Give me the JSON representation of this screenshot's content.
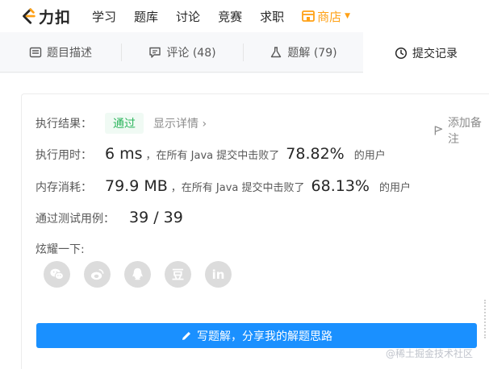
{
  "nav": {
    "logo_text": "力扣",
    "items": [
      "学习",
      "题库",
      "讨论",
      "竞赛",
      "求职"
    ],
    "shop_label": "商店",
    "accent_color": "#ffa116"
  },
  "tabs": [
    {
      "label": "题目描述",
      "icon": "document-icon"
    },
    {
      "label": "评论 (48)",
      "icon": "comment-icon"
    },
    {
      "label": "题解 (79)",
      "icon": "flask-icon"
    },
    {
      "label": "提交记录",
      "icon": "clock-icon",
      "active": true
    }
  ],
  "result": {
    "label": "执行结果：",
    "status": "通过",
    "detail_link": "显示详情 ›",
    "add_note": "添加备注"
  },
  "runtime": {
    "label": "执行用时：",
    "value": "6 ms",
    "prefix": "，在所有 Java 提交中击败了",
    "percent": "78.82%",
    "suffix": "的用户"
  },
  "memory": {
    "label": "内存消耗：",
    "value": "79.9 MB",
    "prefix": "，在所有 Java 提交中击败了",
    "percent": "68.13%",
    "suffix": "的用户"
  },
  "tests": {
    "label": "通过测试用例：",
    "value": "39 / 39"
  },
  "share": {
    "label": "炫耀一下:",
    "icons": [
      "wechat-icon",
      "weibo-icon",
      "qq-icon",
      "douban-icon",
      "linkedin-icon"
    ],
    "douban_glyph": "豆",
    "linkedin_glyph": "in"
  },
  "write_solution_label": "写题解，分享我的解题思路",
  "watermark": "@稀土掘金技术社区",
  "colors": {
    "primary_button": "#1a90ff",
    "pass_green": "#2db55d"
  }
}
